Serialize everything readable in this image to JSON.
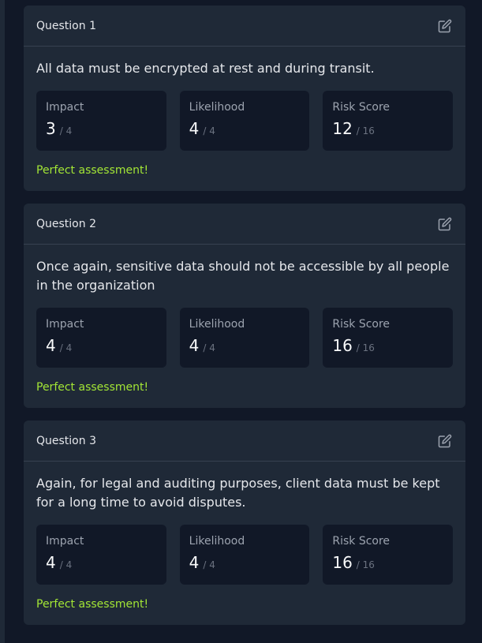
{
  "questions": [
    {
      "title": "Question 1",
      "text": "All data must be encrypted at rest and during transit.",
      "impact": {
        "label": "Impact",
        "value": "3",
        "max": "/ 4"
      },
      "likelihood": {
        "label": "Likelihood",
        "value": "4",
        "max": "/ 4"
      },
      "risk": {
        "label": "Risk Score",
        "value": "12",
        "max": "/ 16"
      },
      "feedback": "Perfect assessment!"
    },
    {
      "title": "Question 2",
      "text": "Once again, sensitive data should not be accessible by all people in the organization",
      "impact": {
        "label": "Impact",
        "value": "4",
        "max": "/ 4"
      },
      "likelihood": {
        "label": "Likelihood",
        "value": "4",
        "max": "/ 4"
      },
      "risk": {
        "label": "Risk Score",
        "value": "16",
        "max": "/ 16"
      },
      "feedback": "Perfect assessment!"
    },
    {
      "title": "Question 3",
      "text": "Again, for legal and auditing purposes, client data must be kept for a long time to avoid disputes.",
      "impact": {
        "label": "Impact",
        "value": "4",
        "max": "/ 4"
      },
      "likelihood": {
        "label": "Likelihood",
        "value": "4",
        "max": "/ 4"
      },
      "risk": {
        "label": "Risk Score",
        "value": "16",
        "max": "/ 16"
      },
      "feedback": "Perfect assessment!"
    }
  ],
  "icons": {
    "edit": "edit-icon"
  },
  "colors": {
    "success": "#a3e635",
    "card": "#1f2937",
    "background": "#111827"
  }
}
